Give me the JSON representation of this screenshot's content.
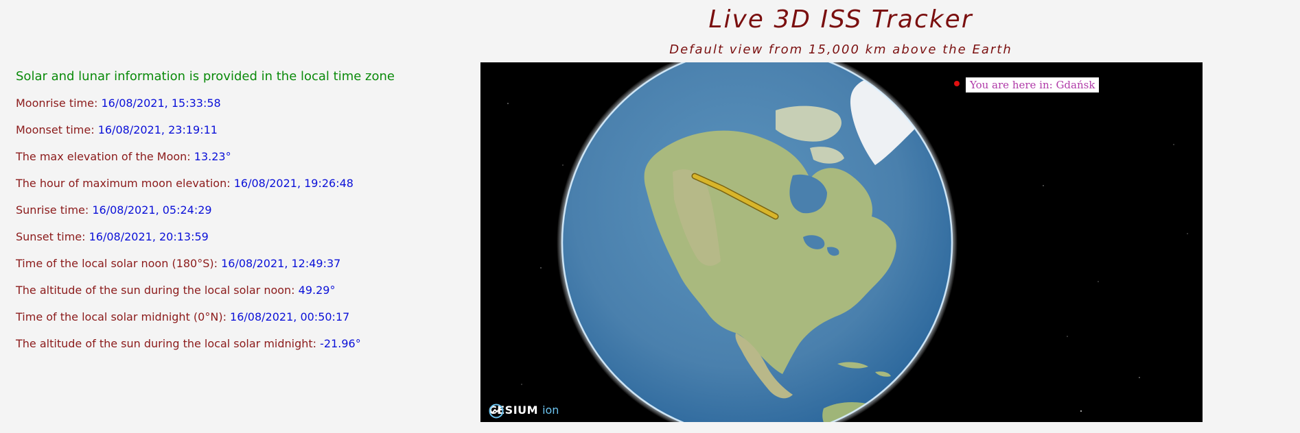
{
  "header": {
    "title": "Live 3D ISS Tracker",
    "subtitle": "Default view from 15,000 km above the Earth"
  },
  "info": {
    "heading": "Solar and lunar information is provided in the local time zone",
    "rows": [
      {
        "label": "Moonrise time: ",
        "value": "16/08/2021, 15:33:58"
      },
      {
        "label": "Moonset time: ",
        "value": "16/08/2021, 23:19:11"
      },
      {
        "label": "The max elevation of the Moon: ",
        "value": "13.23°"
      },
      {
        "label": "The hour of maximum moon elevation: ",
        "value": "16/08/2021, 19:26:48"
      },
      {
        "label": "Sunrise time: ",
        "value": "16/08/2021, 05:24:29"
      },
      {
        "label": "Sunset time: ",
        "value": "16/08/2021, 20:13:59"
      },
      {
        "label": "Time of the local solar noon (180°S): ",
        "value": "16/08/2021, 12:49:37"
      },
      {
        "label": "The altitude of the sun during the local solar noon: ",
        "value": "49.29°"
      },
      {
        "label": "Time of the local solar midnight (0°N): ",
        "value": "16/08/2021, 00:50:17"
      },
      {
        "label": "The altitude of the sun during the local solar midnight: ",
        "value": "-21.96°"
      }
    ]
  },
  "viewer": {
    "location_label": "You are here in: Gdańsk",
    "logo_text": "CESIUM",
    "logo_suffix": "ion",
    "logo_icon": "cesium-ion-icon",
    "colors": {
      "space": "#000000",
      "ocean": "#4f86b0",
      "land": "#a9b97e",
      "ice": "#f2f4f6",
      "iss_track": "#d8b52a",
      "location_marker": "#e01010"
    }
  }
}
